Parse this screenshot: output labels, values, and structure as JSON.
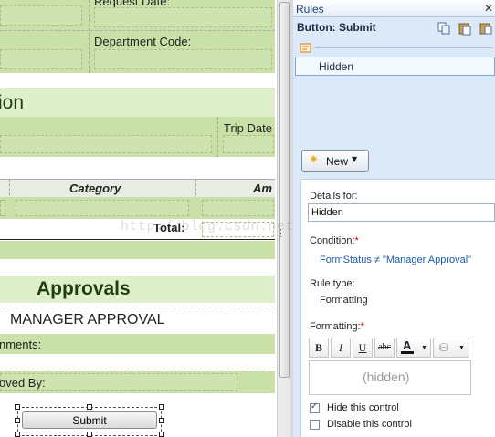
{
  "form": {
    "request_date_label": "Request Date:",
    "department_code_label": "Department Code:",
    "section_title_partial": "ion",
    "trip_date_label": "Trip Date",
    "category_header": "Category",
    "amount_header_partial": "Am",
    "total_label": "Total:",
    "approvals_title": "Approvals",
    "manager_approval_label": "MANAGER APPROVAL",
    "comments_label_partial": "nments:",
    "approved_by_label_partial": "oved By:",
    "submit_label": "Submit"
  },
  "watermark": "http://blog.csdn.net/crazygolf",
  "rules_pane": {
    "title": "Rules",
    "header": "Button: Submit",
    "rule_item": "Hidden",
    "new_button": "New",
    "details_for_label": "Details for:",
    "details_for_value": "Hidden",
    "condition_label": "Condition:",
    "condition_value": "FormStatus ≠ \"Manager Approval\"",
    "rule_type_label": "Rule type:",
    "rule_type_value": "Formatting",
    "formatting_label": "Formatting:",
    "required_marker": "*",
    "format_buttons": [
      "B",
      "I",
      "U",
      "abc"
    ],
    "preview_text": "(hidden)",
    "hide_control_label": "Hide this control",
    "hide_control_checked": true,
    "disable_control_label": "Disable this control",
    "disable_control_checked": false
  },
  "colors": {
    "form_green": "#c9e0a8",
    "pane_blue": "#dce9f8",
    "link_blue": "#1a5aa8",
    "required_red": "#cc0000"
  }
}
